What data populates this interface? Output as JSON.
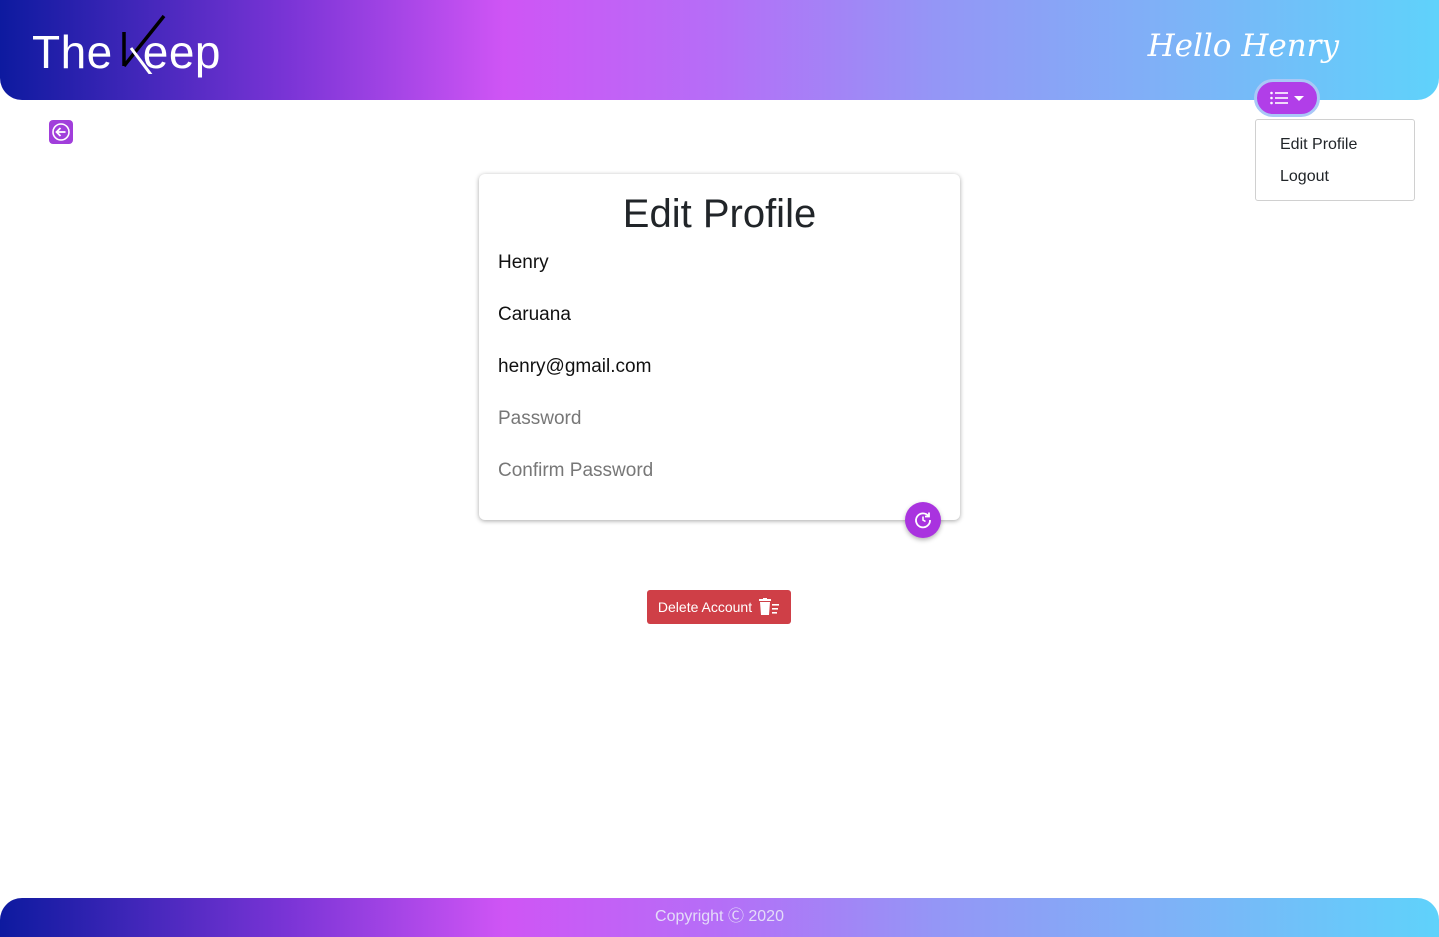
{
  "header": {
    "logo_text_left": "The",
    "logo_text_right": "eep",
    "greeting": "Hello Henry"
  },
  "menu": {
    "button_icon": "list-icon",
    "items": [
      {
        "label": "Edit Profile"
      },
      {
        "label": "Logout"
      }
    ]
  },
  "back_button": {
    "icon": "arrow-left-icon"
  },
  "card": {
    "title": "Edit Profile",
    "fields": {
      "first_name": {
        "value": "Henry",
        "placeholder": ""
      },
      "last_name": {
        "value": "Caruana",
        "placeholder": ""
      },
      "email": {
        "value": "henry@gmail.com",
        "placeholder": ""
      },
      "password": {
        "value": "",
        "placeholder": "Password"
      },
      "confirm_password": {
        "value": "",
        "placeholder": "Confirm Password"
      }
    },
    "submit_icon": "refresh-icon"
  },
  "delete_account": {
    "label": "Delete Account",
    "icon": "trash-icon"
  },
  "footer": {
    "copyright": "Copyright Ⓒ 2020"
  },
  "colors": {
    "accent": "#a933df",
    "danger": "#cf3f47",
    "gradient_start": "#0d1a9f",
    "gradient_mid": "#cf55f5",
    "gradient_end": "#5fd2fb"
  }
}
